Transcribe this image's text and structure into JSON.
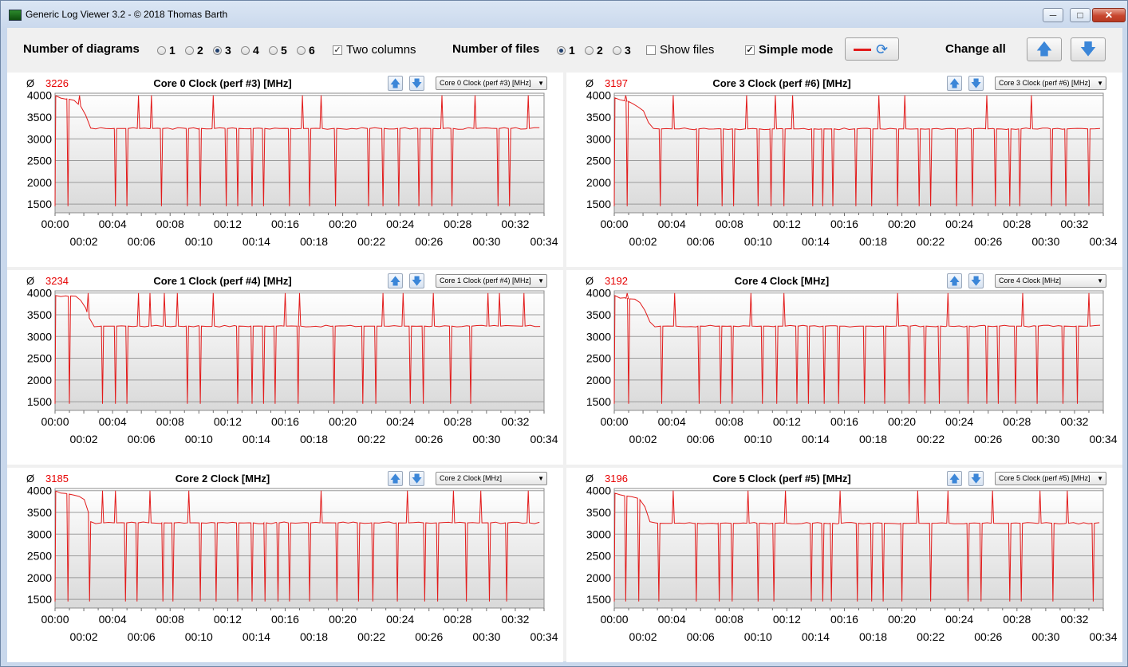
{
  "window": {
    "title": "Generic Log Viewer 3.2 - © 2018 Thomas Barth",
    "minimize": "─",
    "maximize": "□",
    "close": "✕"
  },
  "toolbar": {
    "diagrams_label": "Number of diagrams",
    "diagram_options": [
      "1",
      "2",
      "3",
      "4",
      "5",
      "6"
    ],
    "diagrams_selected": "3",
    "two_columns_label": "Two columns",
    "two_columns_checked": true,
    "files_label": "Number of files",
    "file_options": [
      "1",
      "2",
      "3"
    ],
    "files_selected": "1",
    "show_files_label": "Show files",
    "show_files_checked": false,
    "simple_mode_label": "Simple mode",
    "simple_mode_checked": true,
    "change_all_label": "Change all",
    "line_color": "#e21b1b"
  },
  "panels": [
    {
      "avg_symbol": "Ø",
      "avg": "3226",
      "title": "Core 0 Clock (perf #3) [MHz]",
      "select": "Core 0 Clock (perf #3) [MHz]",
      "col": 0,
      "row": 0
    },
    {
      "avg_symbol": "Ø",
      "avg": "3197",
      "title": "Core 3 Clock (perf #6) [MHz]",
      "select": "Core 3 Clock (perf #6) [MHz]",
      "col": 1,
      "row": 0
    },
    {
      "avg_symbol": "Ø",
      "avg": "3234",
      "title": "Core 1 Clock (perf #4) [MHz]",
      "select": "Core 1 Clock (perf #4) [MHz]",
      "col": 0,
      "row": 1
    },
    {
      "avg_symbol": "Ø",
      "avg": "3192",
      "title": "Core 4 Clock [MHz]",
      "select": "Core 4 Clock [MHz]",
      "col": 1,
      "row": 1
    },
    {
      "avg_symbol": "Ø",
      "avg": "3185",
      "title": "Core 2 Clock [MHz]",
      "select": "Core 2 Clock [MHz]",
      "col": 0,
      "row": 2
    },
    {
      "avg_symbol": "Ø",
      "avg": "3196",
      "title": "Core 5 Clock (perf #5) [MHz]",
      "select": "Core 5 Clock (perf #5) [MHz]",
      "col": 1,
      "row": 2
    }
  ],
  "chart_data": [
    {
      "type": "line",
      "title": "Core 0 Clock (perf #3) [MHz]",
      "line_color": "#e21b1b",
      "xlim": [
        0,
        34
      ],
      "ylim": [
        1300,
        4050
      ],
      "yticks": [
        1500,
        2000,
        2500,
        3000,
        3500,
        4000
      ],
      "xticks_top": [
        "00:00",
        "00:04",
        "00:08",
        "00:12",
        "00:16",
        "00:20",
        "00:24",
        "00:28",
        "00:32"
      ],
      "xticks_bottom": [
        "00:02",
        "00:06",
        "00:10",
        "00:14",
        "00:18",
        "00:22",
        "00:26",
        "00:30",
        "00:34"
      ],
      "baseline": {
        "x": [
          0,
          0.3,
          1.2,
          2.0,
          2.4,
          34
        ],
        "y": [
          4000,
          3950,
          3900,
          3700,
          3240,
          3240
        ]
      },
      "spikes_up": [
        1.7,
        5.8,
        6.7,
        11.0,
        17.2,
        18.5,
        26.9,
        29.2,
        32.9
      ],
      "spikes_down": [
        0.9,
        4.2,
        5.0,
        7.4,
        9.2,
        10.1,
        11.9,
        12.7,
        13.7,
        14.5,
        16.3,
        17.7,
        19.5,
        21.8,
        22.8,
        23.9,
        25.3,
        26.2,
        27.6,
        30.8,
        31.6
      ],
      "spike_low": 1450
    },
    {
      "type": "line",
      "title": "Core 3 Clock (perf #6) [MHz]",
      "line_color": "#e21b1b",
      "xlim": [
        0,
        34
      ],
      "ylim": [
        1300,
        4050
      ],
      "yticks": [
        1500,
        2000,
        2500,
        3000,
        3500,
        4000
      ],
      "xticks_top": [
        "00:00",
        "00:04",
        "00:08",
        "00:12",
        "00:16",
        "00:20",
        "00:24",
        "00:28",
        "00:32"
      ],
      "xticks_bottom": [
        "00:02",
        "00:06",
        "00:10",
        "00:14",
        "00:18",
        "00:22",
        "00:26",
        "00:30",
        "00:34"
      ],
      "baseline": {
        "x": [
          0,
          0.3,
          1.2,
          2.0,
          2.6,
          34
        ],
        "y": [
          3950,
          3900,
          3850,
          3650,
          3230,
          3230
        ]
      },
      "spikes_up": [
        0.8,
        4.1,
        9.2,
        11.2,
        12.4,
        18.4,
        20.2,
        25.9,
        29.0
      ],
      "spikes_down": [
        0.9,
        3.2,
        5.8,
        7.5,
        8.3,
        10.0,
        10.9,
        11.8,
        13.8,
        14.5,
        15.2,
        16.8,
        17.9,
        19.7,
        21.2,
        22.0,
        23.8,
        24.9,
        26.5,
        27.5,
        28.2,
        30.4,
        31.4,
        33.0
      ],
      "spike_low": 1450
    },
    {
      "type": "line",
      "title": "Core 1 Clock (perf #4) [MHz]",
      "line_color": "#e21b1b",
      "xlim": [
        0,
        34
      ],
      "ylim": [
        1300,
        4050
      ],
      "yticks": [
        1500,
        2000,
        2500,
        3000,
        3500,
        4000
      ],
      "xticks_top": [
        "00:00",
        "00:04",
        "00:08",
        "00:12",
        "00:16",
        "00:20",
        "00:24",
        "00:28",
        "00:32"
      ],
      "xticks_bottom": [
        "00:02",
        "00:06",
        "00:10",
        "00:14",
        "00:18",
        "00:22",
        "00:26",
        "00:30",
        "00:34"
      ],
      "baseline": {
        "x": [
          0,
          0.3,
          1.5,
          2.0,
          2.6,
          34
        ],
        "y": [
          3950,
          3900,
          3950,
          3750,
          3240,
          3240
        ]
      },
      "spikes_up": [
        2.3,
        5.8,
        6.6,
        7.6,
        8.5,
        11.0,
        16.0,
        17.0,
        22.8,
        24.2,
        26.3,
        30.1,
        30.9,
        32.6
      ],
      "spikes_down": [
        1.0,
        3.3,
        4.2,
        5.0,
        9.2,
        10.1,
        12.7,
        13.7,
        14.5,
        15.3,
        16.9,
        19.4,
        21.4,
        22.3,
        24.7,
        25.6,
        27.5,
        28.9
      ],
      "spike_low": 1450
    },
    {
      "type": "line",
      "title": "Core 4 Clock [MHz]",
      "line_color": "#e21b1b",
      "xlim": [
        0,
        34
      ],
      "ylim": [
        1300,
        4050
      ],
      "yticks": [
        1500,
        2000,
        2500,
        3000,
        3500,
        4000
      ],
      "xticks_top": [
        "00:00",
        "00:04",
        "00:08",
        "00:12",
        "00:16",
        "00:20",
        "00:24",
        "00:28",
        "00:32"
      ],
      "xticks_bottom": [
        "00:02",
        "00:06",
        "00:10",
        "00:14",
        "00:18",
        "00:22",
        "00:26",
        "00:30",
        "00:34"
      ],
      "baseline": {
        "x": [
          0,
          0.3,
          1.5,
          2.0,
          2.6,
          34
        ],
        "y": [
          3950,
          3900,
          3850,
          3700,
          3240,
          3240
        ]
      },
      "spikes_up": [
        0.9,
        4.2,
        9.5,
        11.8,
        19.7,
        23.2,
        28.4,
        33.0
      ],
      "spikes_down": [
        1.0,
        3.3,
        5.9,
        7.4,
        8.2,
        10.3,
        11.3,
        12.7,
        13.5,
        14.6,
        15.6,
        17.4,
        18.8,
        20.5,
        21.6,
        22.6,
        24.6,
        25.9,
        26.7,
        27.9,
        29.4,
        31.2,
        32.2
      ],
      "spike_low": 1450
    },
    {
      "type": "line",
      "title": "Core 2 Clock [MHz]",
      "line_color": "#e21b1b",
      "xlim": [
        0,
        34
      ],
      "ylim": [
        1300,
        4050
      ],
      "yticks": [
        1500,
        2000,
        2500,
        3000,
        3500,
        4000
      ],
      "xticks_top": [
        "00:00",
        "00:04",
        "00:08",
        "00:12",
        "00:16",
        "00:20",
        "00:24",
        "00:28",
        "00:32"
      ],
      "xticks_bottom": [
        "00:02",
        "00:06",
        "00:10",
        "00:14",
        "00:18",
        "00:22",
        "00:26",
        "00:30",
        "00:34"
      ],
      "baseline": {
        "x": [
          0,
          0.3,
          1.5,
          2.1,
          2.5,
          34
        ],
        "y": [
          4000,
          3950,
          3900,
          3800,
          3260,
          3260
        ]
      },
      "spikes_up": [
        3.3,
        4.2,
        6.6,
        9.3,
        18.5,
        24.5,
        27.7,
        29.6,
        32.9
      ],
      "spikes_down": [
        0.9,
        2.4,
        4.9,
        5.7,
        7.5,
        8.2,
        10.1,
        11.2,
        12.7,
        13.7,
        14.6,
        15.5,
        16.3,
        17.7,
        19.6,
        21.1,
        22.1,
        23.8,
        25.7,
        26.6,
        28.6,
        30.2,
        31.4
      ],
      "spike_low": 1450
    },
    {
      "type": "line",
      "title": "Core 5 Clock (perf #5) [MHz]",
      "line_color": "#e21b1b",
      "xlim": [
        0,
        34
      ],
      "ylim": [
        1300,
        4050
      ],
      "yticks": [
        1500,
        2000,
        2500,
        3000,
        3500,
        4000
      ],
      "xticks_top": [
        "00:00",
        "00:04",
        "00:08",
        "00:12",
        "00:16",
        "00:20",
        "00:24",
        "00:28",
        "00:32"
      ],
      "xticks_bottom": [
        "00:02",
        "00:06",
        "00:10",
        "00:14",
        "00:18",
        "00:22",
        "00:26",
        "00:30",
        "00:34"
      ],
      "baseline": {
        "x": [
          0,
          0.3,
          1.5,
          2.0,
          2.5,
          34
        ],
        "y": [
          3950,
          3900,
          3850,
          3750,
          3250,
          3250
        ]
      },
      "spikes_up": [
        4.1,
        9.3,
        11.9,
        15.7,
        21.1,
        23.2,
        26.3,
        29.6,
        31.5
      ],
      "spikes_down": [
        0.8,
        1.7,
        3.1,
        5.7,
        7.3,
        8.2,
        10.0,
        11.1,
        13.7,
        14.5,
        15.1,
        16.9,
        17.9,
        18.7,
        20.0,
        22.0,
        24.6,
        25.5,
        27.5,
        28.3,
        30.5,
        33.3
      ],
      "spike_low": 1450
    }
  ]
}
